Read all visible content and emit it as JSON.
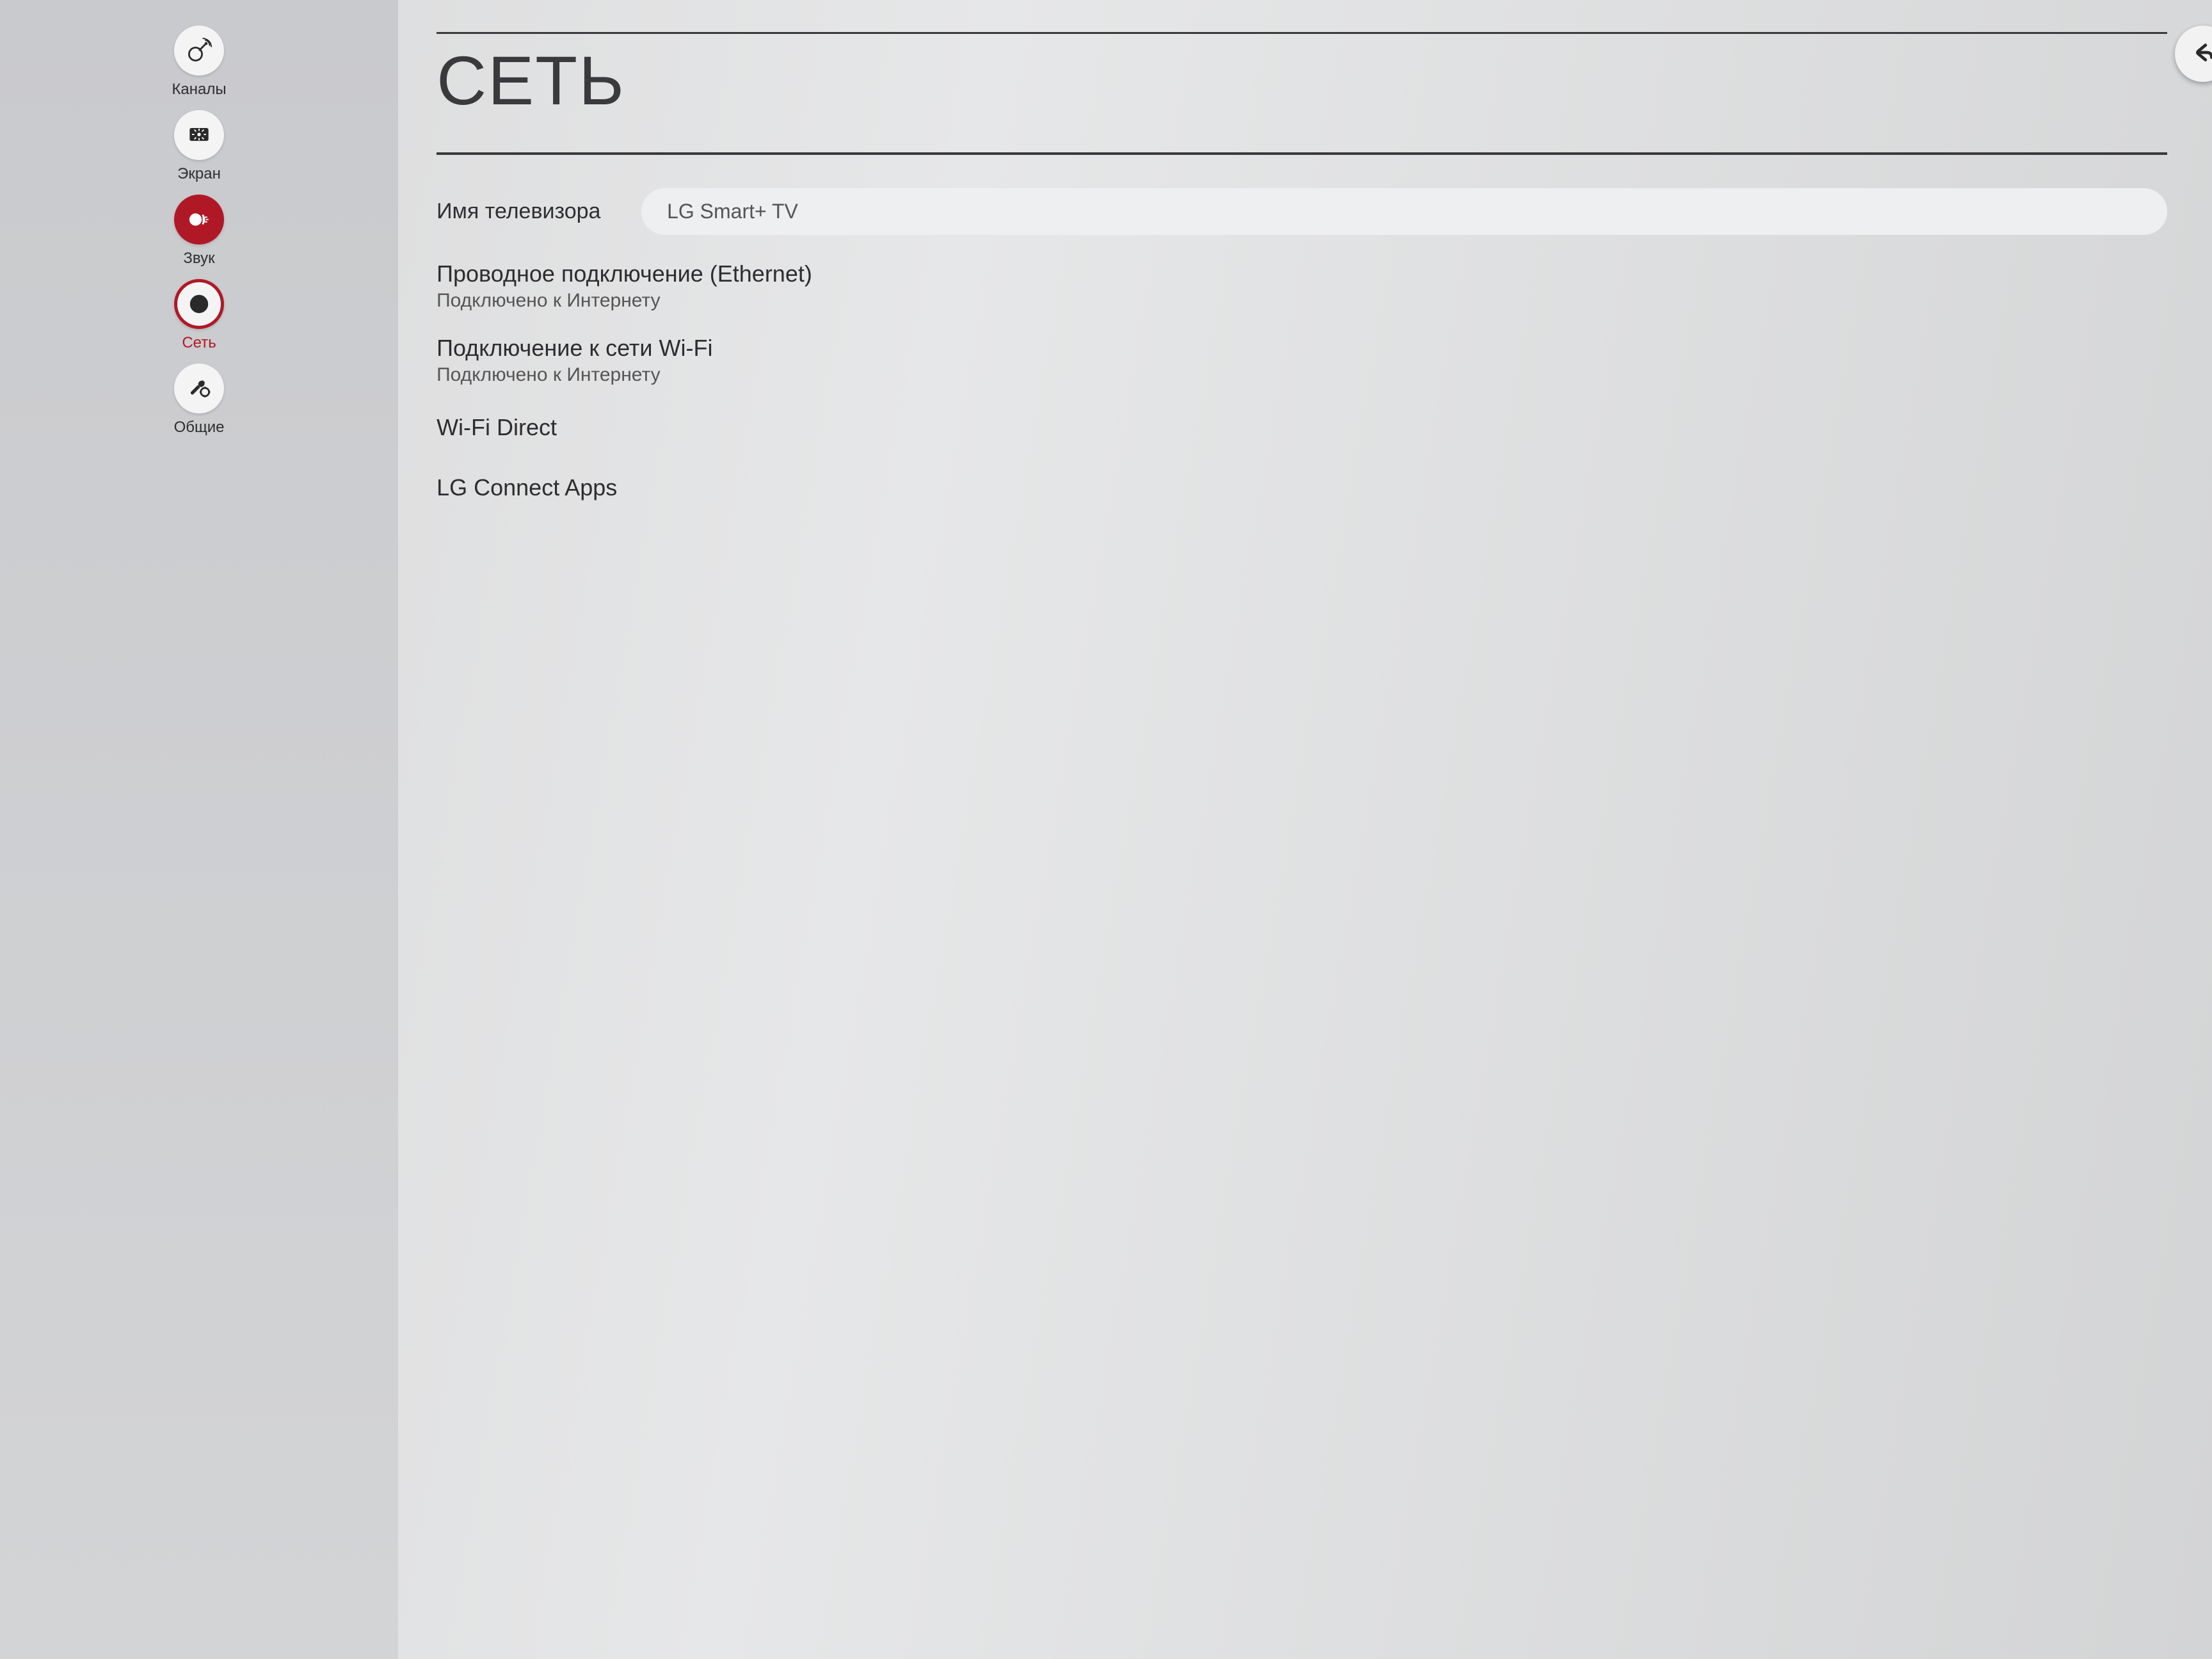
{
  "colors": {
    "accent": "#b11826"
  },
  "sidebar": {
    "items": [
      {
        "label": "Каналы",
        "icon": "satellite"
      },
      {
        "label": "Экран",
        "icon": "screen"
      },
      {
        "label": "Звук",
        "icon": "sound"
      },
      {
        "label": "Сеть",
        "icon": "network"
      },
      {
        "label": "Общие",
        "icon": "settings"
      }
    ],
    "selected_index": 3
  },
  "main": {
    "title": "СЕТЬ",
    "tv_name": {
      "label": "Имя телевизора",
      "value": "LG Smart+ TV"
    },
    "ethernet": {
      "title": "Проводное подключение (Ethernet)",
      "status": "Подключено к Интернету"
    },
    "wifi": {
      "title": "Подключение к сети Wi-Fi",
      "status": "Подключено к Интернету"
    },
    "wifi_direct": {
      "title": "Wi-Fi Direct"
    },
    "connect_apps": {
      "title": "LG Connect Apps"
    }
  },
  "back_button": {
    "label": "Назад"
  }
}
